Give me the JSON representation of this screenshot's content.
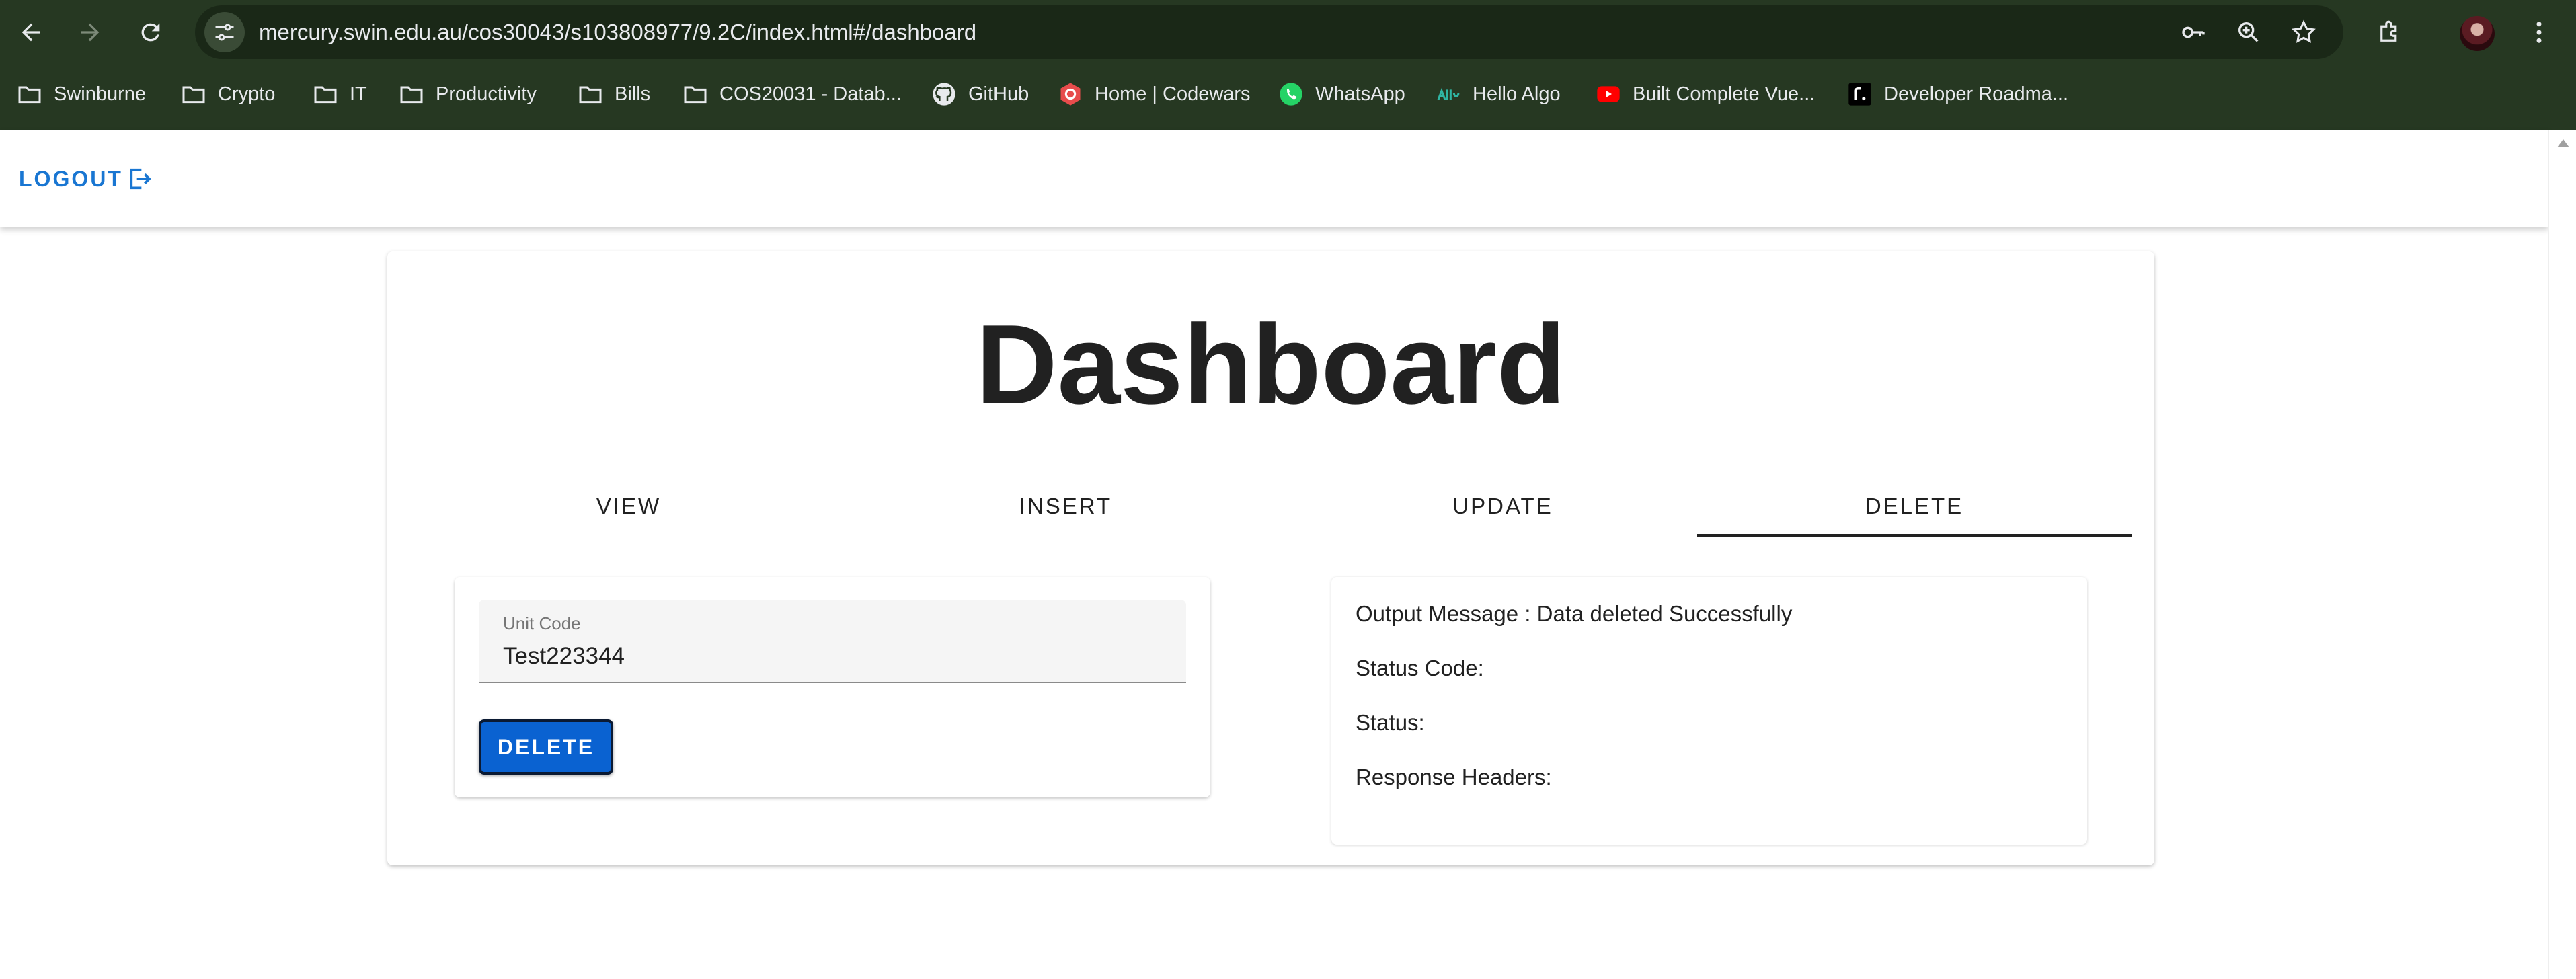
{
  "browser": {
    "url": "mercury.swin.edu.au/cos30043/s103808977/9.2C/index.html#/dashboard",
    "bookmarks": [
      {
        "label": "Swinburne",
        "icon": "folder-icon"
      },
      {
        "label": "Crypto",
        "icon": "folder-icon"
      },
      {
        "label": "IT",
        "icon": "folder-icon"
      },
      {
        "label": "Productivity",
        "icon": "folder-icon"
      },
      {
        "label": "Bills",
        "icon": "folder-icon"
      },
      {
        "label": "COS20031 - Datab...",
        "icon": "folder-icon"
      },
      {
        "label": "GitHub",
        "icon": "github-icon"
      },
      {
        "label": "Home | Codewars",
        "icon": "codewars-icon"
      },
      {
        "label": "WhatsApp",
        "icon": "whatsapp-icon"
      },
      {
        "label": "Hello Algo",
        "icon": "hello-algo-icon"
      },
      {
        "label": "Built Complete Vue...",
        "icon": "youtube-icon"
      },
      {
        "label": "Developer Roadma...",
        "icon": "roadmap-icon"
      }
    ]
  },
  "appbar": {
    "logout_label": "LOGOUT"
  },
  "dashboard": {
    "title": "Dashboard",
    "tabs": [
      {
        "label": "VIEW",
        "active": false
      },
      {
        "label": "INSERT",
        "active": false
      },
      {
        "label": "UPDATE",
        "active": false
      },
      {
        "label": "DELETE",
        "active": true
      }
    ],
    "form": {
      "field_label": "Unit Code",
      "field_value": "Test223344",
      "button_label": "DELETE"
    },
    "output": {
      "message": "Output Message : Data deleted Successfully",
      "status_code": "Status Code:",
      "status": "Status:",
      "response_headers": "Response Headers:"
    }
  },
  "colors": {
    "chrome_bg": "#263822",
    "omnibox_bg": "#1a2817",
    "accent": "#1976d2",
    "button_bg": "#0a62d1"
  }
}
